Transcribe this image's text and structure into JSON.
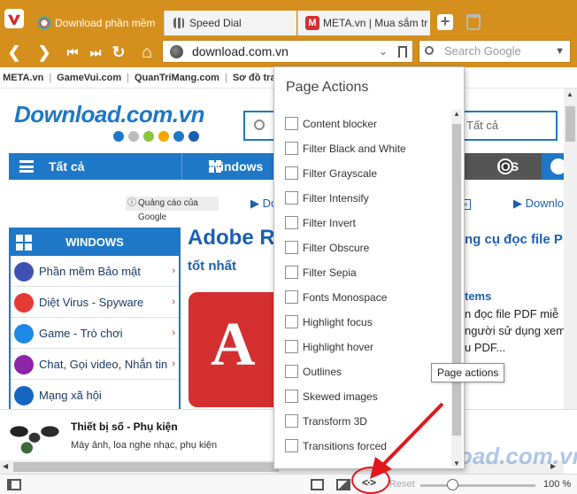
{
  "tabs": [
    {
      "label": "Download phần mềm",
      "icon": "download-site-icon"
    },
    {
      "label": "Speed Dial",
      "icon": "speed-dial-icon"
    },
    {
      "label": "META.vn | Mua sắm tr",
      "icon": "meta-icon",
      "icon_text": "M"
    }
  ],
  "nav": {
    "back": "❮",
    "forward": "❯",
    "rewind": "⏮",
    "fastforward": "⏭",
    "reload": "↻",
    "home": "⌂"
  },
  "address": {
    "url": "download.com.vn",
    "dropdown": "⌄"
  },
  "search": {
    "placeholder": "Search Google",
    "dropdown": "▼"
  },
  "bookmarks": [
    "META.vn",
    "GameVui.com",
    "QuanTriMang.com",
    "Sơ đồ trang"
  ],
  "site": {
    "logo": "Download.com.vn",
    "logo_dots": [
      "#1f77c7",
      "#bbbbbb",
      "#8cc63f",
      "#f7a600",
      "#1f77c7",
      "#1a5fb4"
    ],
    "search_category": "Tất cả",
    "categories": {
      "all": "Tất cả",
      "windows": "Windows",
      "ios": "iOS"
    },
    "ads_label": "Quảng cáo của Google",
    "ad_link_1": "▶ Do",
    "ad_link_2": "▶ Downlo",
    "windows_panel": {
      "title": "WINDOWS",
      "items": [
        {
          "label": "Phần mềm Bảo mật",
          "color": "#3f51b5"
        },
        {
          "label": "Diệt Virus - Spyware",
          "color": "#e53935"
        },
        {
          "label": "Game - Trò chơi",
          "color": "#1e88e5"
        },
        {
          "label": "Chat, Gọi video, Nhắn tin",
          "color": "#8e24aa"
        },
        {
          "label": "Mạng xã hội",
          "color": "#1565c0"
        }
      ]
    },
    "article": {
      "title": "Adobe R",
      "subtitle": "tốt nhất",
      "right_title": "ng cụ đọc file P",
      "right_head": "tems",
      "right_lines": [
        "n đọc file PDF miễ",
        "người sử dụng xem",
        "u PDF..."
      ]
    },
    "ad_strip": {
      "title": "Thiết bị số - Phụ kiện",
      "desc": "Máy ảnh, loa nghe nhạc, phụ kiện"
    }
  },
  "page_actions": {
    "title": "Page Actions",
    "items": [
      "Content blocker",
      "Filter Black and White",
      "Filter Grayscale",
      "Filter Intensify",
      "Filter Invert",
      "Filter Obscure",
      "Filter Sepia",
      "Fonts Monospace",
      "Highlight focus",
      "Highlight hover",
      "Outlines",
      "Skewed images",
      "Transform 3D",
      "Transitions forced"
    ]
  },
  "tooltip": "Page actions",
  "statusbar": {
    "actions_icon": "<·>",
    "reset": "Reset",
    "zoom": "100 %"
  },
  "watermark": "Download.com.vn",
  "colors": {
    "accent": "#d58f1d",
    "site_blue": "#1f77c7",
    "annotation_red": "#e0181e"
  }
}
